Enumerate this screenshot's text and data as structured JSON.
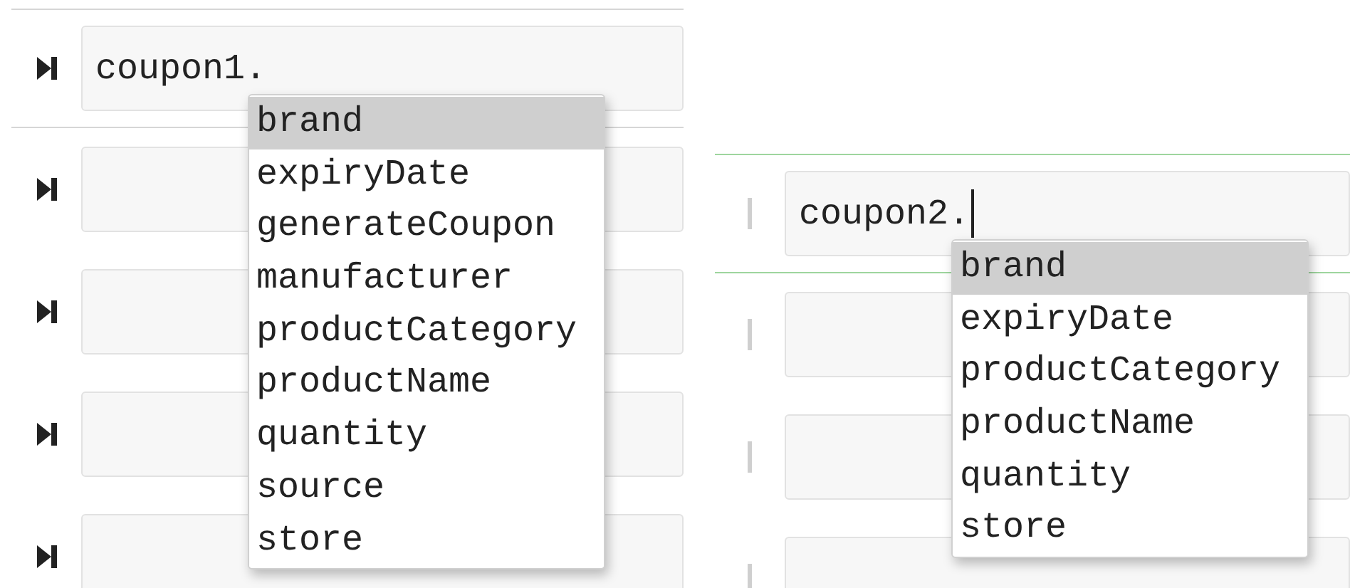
{
  "panels": [
    {
      "kind": "run",
      "focused": false,
      "cells": [
        {
          "text": "coupon1."
        },
        {
          "text": ""
        },
        {
          "text": ""
        },
        {
          "text": ""
        },
        {
          "text": ""
        }
      ],
      "completions": [
        {
          "label": "brand",
          "selected": true
        },
        {
          "label": "expiryDate",
          "selected": false
        },
        {
          "label": "generateCoupon",
          "selected": false
        },
        {
          "label": "manufacturer",
          "selected": false
        },
        {
          "label": "productCategory",
          "selected": false
        },
        {
          "label": "productName",
          "selected": false
        },
        {
          "label": "quantity",
          "selected": false
        },
        {
          "label": "source",
          "selected": false
        },
        {
          "label": "store",
          "selected": false
        }
      ]
    },
    {
      "kind": "bar",
      "focused": true,
      "cells": [
        {
          "text": "coupon2."
        },
        {
          "text": ""
        },
        {
          "text": ""
        },
        {
          "text": ""
        }
      ],
      "completions": [
        {
          "label": "brand",
          "selected": true
        },
        {
          "label": "expiryDate",
          "selected": false
        },
        {
          "label": "productCategory",
          "selected": false
        },
        {
          "label": "productName",
          "selected": false
        },
        {
          "label": "quantity",
          "selected": false
        },
        {
          "label": "store",
          "selected": false
        }
      ]
    }
  ]
}
